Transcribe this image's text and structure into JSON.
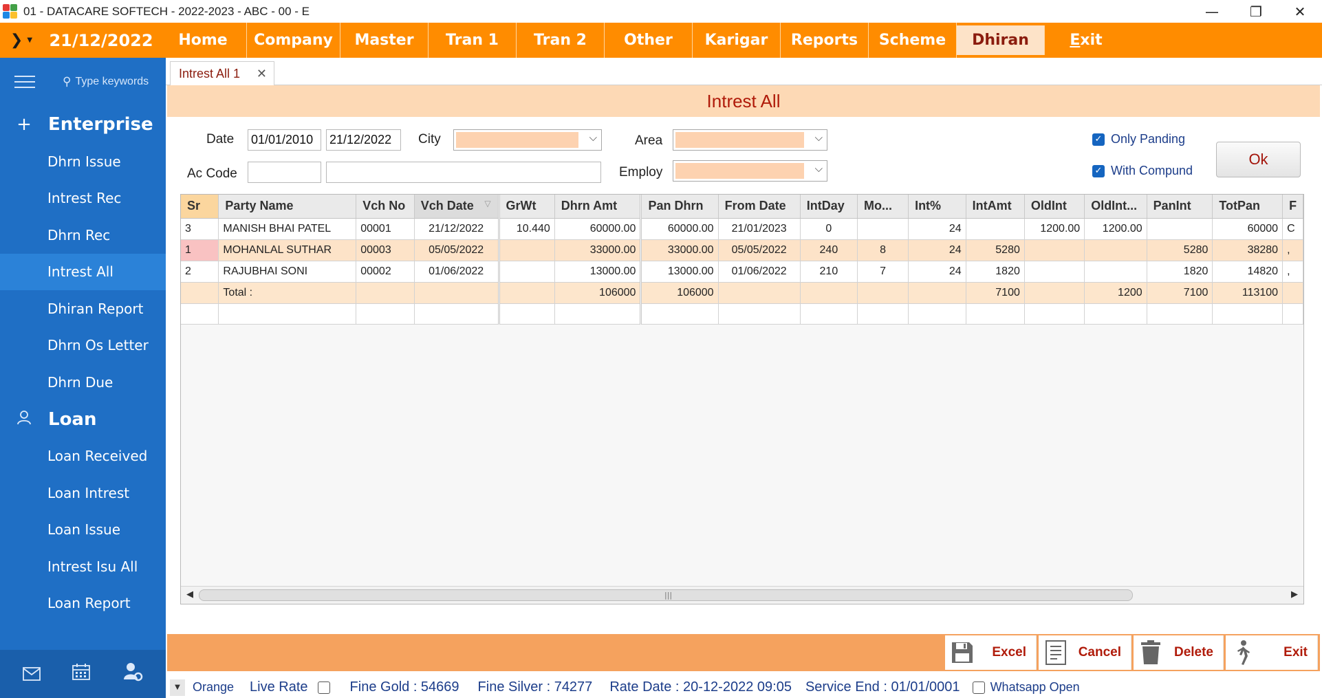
{
  "window": {
    "title": "01 - DATACARE SOFTECH - 2022-2023 - ABC - 00 - E",
    "controls": {
      "minimize": "—",
      "restore": "❐",
      "close": "✕"
    }
  },
  "menubar": {
    "toggle": "❯",
    "date": "21/12/2022",
    "items": [
      "Home",
      "Company",
      "Master",
      "Tran 1",
      "Tran 2",
      "Other",
      "Karigar",
      "Reports",
      "Scheme",
      "Dhiran"
    ],
    "active": "Dhiran",
    "exit_prefix": "E",
    "exit_rest": "xit"
  },
  "sidebar": {
    "search_placeholder": "Type keywords",
    "sections": [
      {
        "title": "Enterprise",
        "icon": "plus-icon",
        "items": [
          "Dhrn Issue",
          "Intrest Rec",
          "Dhrn Rec",
          "Intrest All",
          "Dhiran Report",
          "Dhrn Os Letter",
          "Dhrn Due"
        ]
      },
      {
        "title": "Loan",
        "icon": "user-icon",
        "items": [
          "Loan Received",
          "Loan Intrest",
          "Loan Issue",
          "Intrest Isu All",
          "Loan Report"
        ]
      }
    ],
    "active_item": "Intrest All"
  },
  "tab": {
    "label": "Intrest All 1",
    "close": "✕"
  },
  "form": {
    "title": "Intrest All",
    "date_label": "Date",
    "date_from": "01/01/2010",
    "date_to": "21/12/2022",
    "city_label": "City",
    "area_label": "Area",
    "ac_code_label": "Ac Code",
    "ac_code_value": "",
    "ac_name_value": "",
    "employ_label": "Employ",
    "only_panding_label": "Only Panding",
    "with_compund_label": "With Compund",
    "ok_label": "Ok"
  },
  "grid": {
    "columns": [
      "Sr",
      "Party Name",
      "Vch No",
      "Vch Date",
      "GrWt",
      "Dhrn Amt",
      "Pan Dhrn",
      "From Date",
      "IntDay",
      "Mo...",
      "Int%",
      "IntAmt",
      "OldInt",
      "OldInt...",
      "PanInt",
      "TotPan",
      "F"
    ],
    "rows": [
      {
        "sr": "3",
        "party": "MANISH BHAI PATEL",
        "vch_no": "00001",
        "vch_date": "21/12/2022",
        "grwt": "10.440",
        "dhrn_amt": "60000.00",
        "pan_dhrn": "60000.00",
        "from_date": "21/01/2023",
        "int_day": "0",
        "mo": "",
        "int_pct": "24",
        "int_amt": "",
        "old_int": "1200.00",
        "old_int2": "1200.00",
        "pan_int": "",
        "tot_pan": "60000",
        "f": "C"
      },
      {
        "sr": "1",
        "party": "MOHANLAL SUTHAR",
        "vch_no": "00003",
        "vch_date": "05/05/2022",
        "grwt": "",
        "dhrn_amt": "33000.00",
        "pan_dhrn": "33000.00",
        "from_date": "05/05/2022",
        "int_day": "240",
        "mo": "8",
        "int_pct": "24",
        "int_amt": "5280",
        "old_int": "",
        "old_int2": "",
        "pan_int": "5280",
        "tot_pan": "38280",
        "f": ","
      },
      {
        "sr": "2",
        "party": "RAJUBHAI SONI",
        "vch_no": "00002",
        "vch_date": "01/06/2022",
        "grwt": "",
        "dhrn_amt": "13000.00",
        "pan_dhrn": "13000.00",
        "from_date": "01/06/2022",
        "int_day": "210",
        "mo": "7",
        "int_pct": "24",
        "int_amt": "1820",
        "old_int": "",
        "old_int2": "",
        "pan_int": "1820",
        "tot_pan": "14820",
        "f": ","
      }
    ],
    "total": {
      "label": "Total :",
      "dhrn_amt": "106000",
      "pan_dhrn": "106000",
      "int_amt": "7100",
      "old_int2": "1200",
      "pan_int": "7100",
      "tot_pan": "113100"
    },
    "scroll": {
      "left": "◀",
      "right": "▶",
      "grip": "|||"
    }
  },
  "actions": {
    "excel": "Excel",
    "cancel": "Cancel",
    "delete": "Delete",
    "exit": "Exit"
  },
  "statusbar": {
    "theme": "Orange",
    "live_rate": "Live Rate",
    "fine_gold": "Fine Gold : 54669",
    "fine_silver": "Fine Silver : 74277",
    "rate_date": "Rate Date : 20-12-2022 09:05",
    "service_end": "Service End :  01/01/0001",
    "whatsapp": "Whatsapp Open"
  },
  "colors": {
    "accent": "#ff8c00",
    "sidebar": "#1f6fc5",
    "header": "#fdd9b5",
    "title_red": "#b01b0a"
  }
}
